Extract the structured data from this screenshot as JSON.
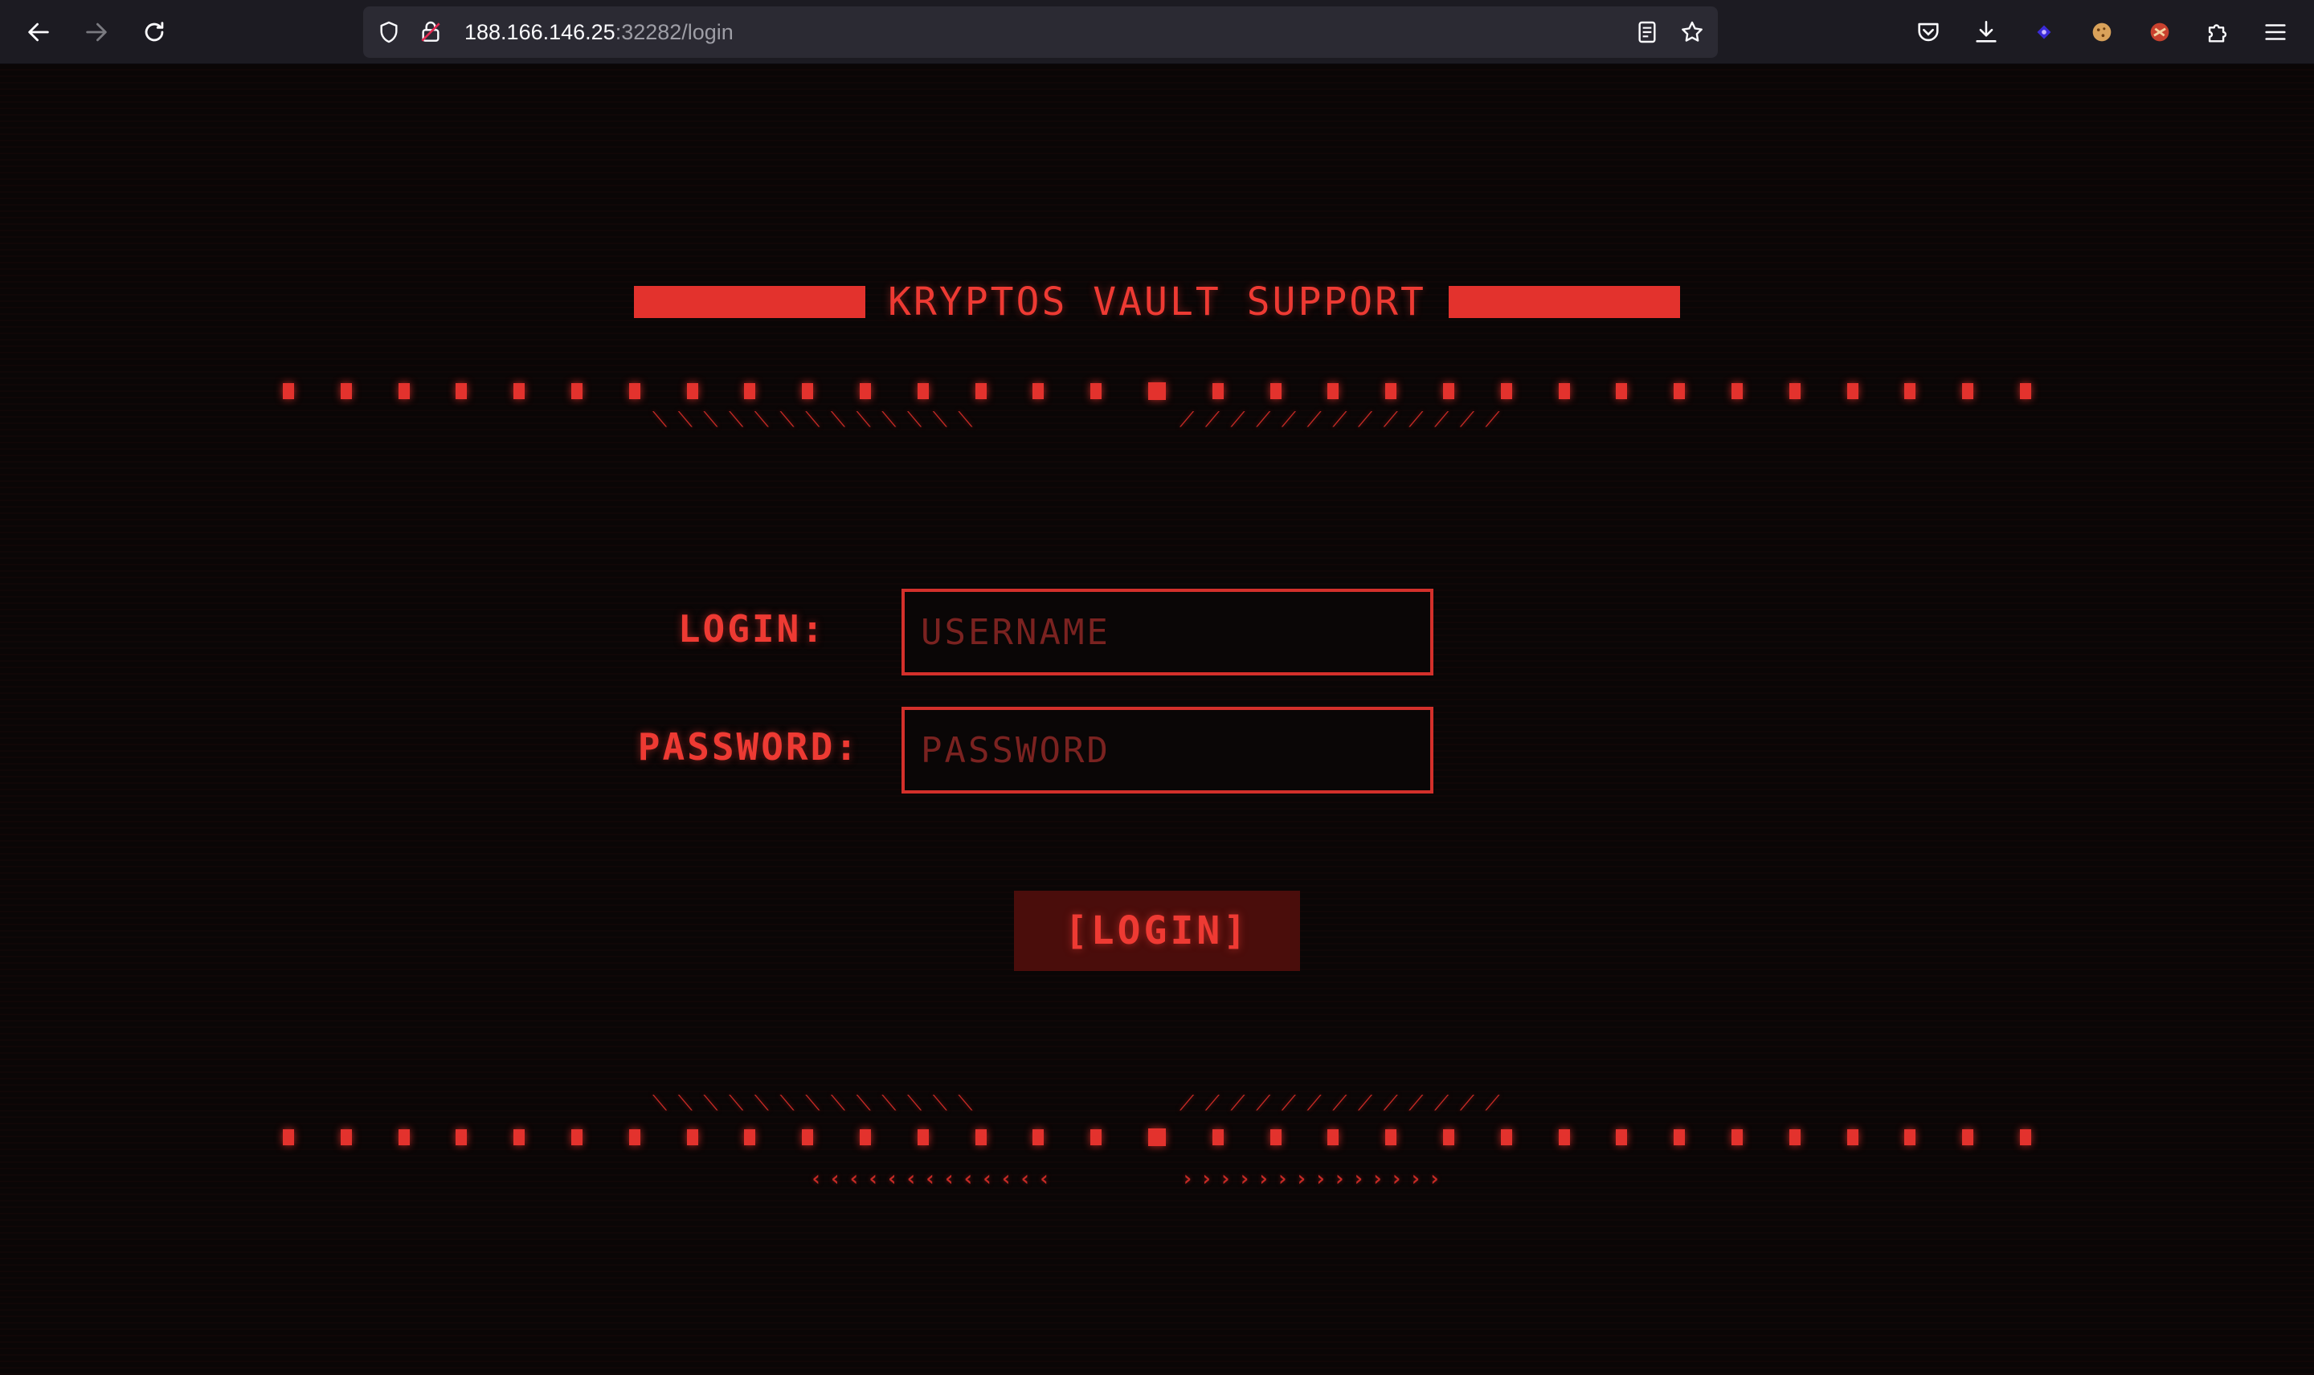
{
  "browser": {
    "url_host": "188.166.146.25",
    "url_path": ":32282/login",
    "icons": [
      "back-arrow-icon",
      "forward-arrow-icon",
      "reload-icon",
      "shield-icon",
      "insecure-lock-icon",
      "reader-view-icon",
      "bookmark-star-icon",
      "pocket-icon",
      "download-icon",
      "extension-purple-icon",
      "cookie-extension-icon",
      "red-extension-icon",
      "extensions-puzzle-icon",
      "hamburger-menu-icon"
    ]
  },
  "colors": {
    "accent": "#e3322d",
    "text_red": "#ee3a33",
    "background": "#0a0606",
    "button_bg": "#4a0d0b"
  },
  "header": {
    "title": "KRYPTOS VAULT SUPPORT"
  },
  "decor": {
    "slashes_left": "⟍⟍⟍⟍⟍⟍⟍⟍⟍⟍⟍⟍⟍",
    "slashes_right": "⟋⟋⟋⟋⟋⟋⟋⟋⟋⟋⟋⟋⟋",
    "chevrons_left": "‹‹‹‹‹‹‹‹‹‹‹‹‹",
    "chevrons_right": "››››››››››››››"
  },
  "form": {
    "login_label": "LOGIN:",
    "username_placeholder": "USERNAME",
    "username_value": "",
    "password_label": "PASSWORD:",
    "password_placeholder": "PASSWORD",
    "password_value": "",
    "submit_label": "[LOGIN]"
  }
}
